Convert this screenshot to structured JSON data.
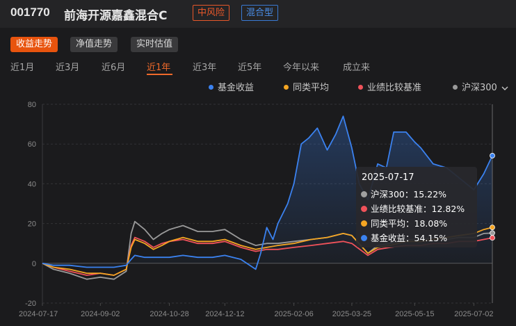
{
  "header": {
    "fund_code": "001770",
    "fund_name": "前海开源嘉鑫混合C",
    "risk_badge": "中风险",
    "type_badge": "混合型"
  },
  "view_tabs": [
    {
      "label": "收益走势",
      "active": true
    },
    {
      "label": "净值走势",
      "active": false
    },
    {
      "label": "实时估值",
      "active": false
    }
  ],
  "period_tabs": [
    {
      "label": "近1月",
      "active": false
    },
    {
      "label": "近3月",
      "active": false
    },
    {
      "label": "近6月",
      "active": false
    },
    {
      "label": "近1年",
      "active": true
    },
    {
      "label": "近3年",
      "active": false
    },
    {
      "label": "近5年",
      "active": false
    },
    {
      "label": "今年以来",
      "active": false
    },
    {
      "label": "成立来",
      "active": false
    }
  ],
  "legend": [
    {
      "label": "基金收益",
      "color": "#3b82f0"
    },
    {
      "label": "同类平均",
      "color": "#f5a623"
    },
    {
      "label": "业绩比较基准",
      "color": "#f0525a"
    },
    {
      "label": "沪深300",
      "color": "#9a9a9a"
    }
  ],
  "legend_more_icon": "chevron-down-icon",
  "tooltip": {
    "date": "2025-07-17",
    "rows": [
      {
        "label": "沪深300：15.22%",
        "color": "#a0a0a0"
      },
      {
        "label": "业绩比较基准：12.82%",
        "color": "#f0525a"
      },
      {
        "label": "同类平均：18.08%",
        "color": "#f5a623"
      },
      {
        "label": "基金收益：54.15%",
        "color": "#3b82f0"
      }
    ]
  },
  "chart_data": {
    "type": "line",
    "y_ticks": [
      "80",
      "60",
      "40",
      "20",
      "0",
      "-20"
    ],
    "x_ticks": [
      "2024-07-17",
      "2024-09-02",
      "2024-10-28",
      "2024-12-12",
      "2025-02-06",
      "2025-03-25",
      "2025-05-15",
      "2025-07-02"
    ],
    "ylim": [
      -20,
      80
    ],
    "xlim": [
      "2024-07-17",
      "2025-07-17"
    ],
    "grid": true,
    "legend_position": "top-right",
    "series": [
      {
        "name": "沪深300",
        "color": "#9a9a9a",
        "points": [
          [
            "2024-07-17",
            0
          ],
          [
            "2024-07-26",
            -3
          ],
          [
            "2024-08-08",
            -5
          ],
          [
            "2024-08-22",
            -8
          ],
          [
            "2024-09-02",
            -7
          ],
          [
            "2024-09-13",
            -8
          ],
          [
            "2024-09-23",
            -4
          ],
          [
            "2024-09-27",
            15
          ],
          [
            "2024-09-30",
            21
          ],
          [
            "2024-10-08",
            17
          ],
          [
            "2024-10-15",
            12
          ],
          [
            "2024-10-22",
            15
          ],
          [
            "2024-10-28",
            17
          ],
          [
            "2024-11-08",
            19
          ],
          [
            "2024-11-20",
            16
          ],
          [
            "2024-12-02",
            16
          ],
          [
            "2024-12-12",
            17
          ],
          [
            "2024-12-25",
            12
          ],
          [
            "2025-01-06",
            9
          ],
          [
            "2025-01-15",
            10
          ],
          [
            "2025-01-24",
            10
          ],
          [
            "2025-02-06",
            11
          ],
          [
            "2025-02-20",
            12
          ],
          [
            "2025-03-05",
            13
          ],
          [
            "2025-03-18",
            15
          ],
          [
            "2025-03-25",
            14
          ],
          [
            "2025-04-07",
            5
          ],
          [
            "2025-04-15",
            9
          ],
          [
            "2025-04-25",
            10
          ],
          [
            "2025-05-08",
            12
          ],
          [
            "2025-05-20",
            12
          ],
          [
            "2025-05-30",
            13
          ],
          [
            "2025-06-10",
            12
          ],
          [
            "2025-06-20",
            13
          ],
          [
            "2025-07-02",
            13
          ],
          [
            "2025-07-10",
            15
          ],
          [
            "2025-07-17",
            15.22
          ]
        ]
      },
      {
        "name": "业绩比较基准",
        "color": "#f0525a",
        "points": [
          [
            "2024-07-17",
            0
          ],
          [
            "2024-07-26",
            -2
          ],
          [
            "2024-08-08",
            -4
          ],
          [
            "2024-08-22",
            -6
          ],
          [
            "2024-09-02",
            -5
          ],
          [
            "2024-09-13",
            -6
          ],
          [
            "2024-09-23",
            -3
          ],
          [
            "2024-09-27",
            9
          ],
          [
            "2024-09-30",
            13
          ],
          [
            "2024-10-08",
            11
          ],
          [
            "2024-10-15",
            8
          ],
          [
            "2024-10-22",
            10
          ],
          [
            "2024-10-28",
            11
          ],
          [
            "2024-11-08",
            12
          ],
          [
            "2024-11-20",
            10
          ],
          [
            "2024-12-02",
            10
          ],
          [
            "2024-12-12",
            11
          ],
          [
            "2024-12-25",
            8
          ],
          [
            "2025-01-06",
            6
          ],
          [
            "2025-01-15",
            7
          ],
          [
            "2025-01-24",
            7
          ],
          [
            "2025-02-06",
            8
          ],
          [
            "2025-02-20",
            9
          ],
          [
            "2025-03-05",
            10
          ],
          [
            "2025-03-18",
            11
          ],
          [
            "2025-03-25",
            10
          ],
          [
            "2025-04-07",
            4
          ],
          [
            "2025-04-15",
            7
          ],
          [
            "2025-04-25",
            8
          ],
          [
            "2025-05-08",
            9
          ],
          [
            "2025-05-20",
            9
          ],
          [
            "2025-05-30",
            10
          ],
          [
            "2025-06-10",
            10
          ],
          [
            "2025-06-20",
            11
          ],
          [
            "2025-07-02",
            11
          ],
          [
            "2025-07-10",
            12
          ],
          [
            "2025-07-17",
            12.82
          ]
        ]
      },
      {
        "name": "同类平均",
        "color": "#f5a623",
        "points": [
          [
            "2024-07-17",
            0
          ],
          [
            "2024-07-26",
            -2
          ],
          [
            "2024-08-08",
            -3
          ],
          [
            "2024-08-22",
            -5
          ],
          [
            "2024-09-02",
            -5
          ],
          [
            "2024-09-13",
            -6
          ],
          [
            "2024-09-23",
            -3
          ],
          [
            "2024-09-27",
            8
          ],
          [
            "2024-09-30",
            12
          ],
          [
            "2024-10-08",
            10
          ],
          [
            "2024-10-15",
            7
          ],
          [
            "2024-10-22",
            9
          ],
          [
            "2024-10-28",
            11
          ],
          [
            "2024-11-08",
            13
          ],
          [
            "2024-11-20",
            11
          ],
          [
            "2024-12-02",
            11
          ],
          [
            "2024-12-12",
            12
          ],
          [
            "2024-12-25",
            9
          ],
          [
            "2025-01-06",
            7
          ],
          [
            "2025-01-15",
            8
          ],
          [
            "2025-01-24",
            9
          ],
          [
            "2025-02-06",
            10
          ],
          [
            "2025-02-20",
            12
          ],
          [
            "2025-03-05",
            13
          ],
          [
            "2025-03-18",
            15
          ],
          [
            "2025-03-25",
            14
          ],
          [
            "2025-04-07",
            5
          ],
          [
            "2025-04-15",
            8
          ],
          [
            "2025-04-25",
            9
          ],
          [
            "2025-05-08",
            11
          ],
          [
            "2025-05-20",
            11
          ],
          [
            "2025-05-30",
            12
          ],
          [
            "2025-06-10",
            13
          ],
          [
            "2025-06-20",
            14
          ],
          [
            "2025-07-02",
            15
          ],
          [
            "2025-07-10",
            17
          ],
          [
            "2025-07-17",
            18.08
          ]
        ]
      },
      {
        "name": "基金收益",
        "color": "#3b82f0",
        "points": [
          [
            "2024-07-17",
            0
          ],
          [
            "2024-07-26",
            -1
          ],
          [
            "2024-08-08",
            -1
          ],
          [
            "2024-08-22",
            -2
          ],
          [
            "2024-09-02",
            -2
          ],
          [
            "2024-09-13",
            -2
          ],
          [
            "2024-09-23",
            -1
          ],
          [
            "2024-09-27",
            2
          ],
          [
            "2024-09-30",
            4
          ],
          [
            "2024-10-08",
            3
          ],
          [
            "2024-10-15",
            3
          ],
          [
            "2024-10-22",
            3
          ],
          [
            "2024-10-28",
            3
          ],
          [
            "2024-11-08",
            4
          ],
          [
            "2024-11-20",
            3
          ],
          [
            "2024-12-02",
            3
          ],
          [
            "2024-12-12",
            4
          ],
          [
            "2024-12-25",
            2
          ],
          [
            "2025-01-06",
            -3
          ],
          [
            "2025-01-10",
            5
          ],
          [
            "2025-01-15",
            18
          ],
          [
            "2025-01-20",
            12
          ],
          [
            "2025-01-24",
            20
          ],
          [
            "2025-02-01",
            30
          ],
          [
            "2025-02-06",
            40
          ],
          [
            "2025-02-12",
            60
          ],
          [
            "2025-02-18",
            63
          ],
          [
            "2025-02-25",
            68
          ],
          [
            "2025-03-05",
            57
          ],
          [
            "2025-03-12",
            65
          ],
          [
            "2025-03-18",
            74
          ],
          [
            "2025-03-25",
            58
          ],
          [
            "2025-03-31",
            40
          ],
          [
            "2025-04-07",
            32
          ],
          [
            "2025-04-15",
            50
          ],
          [
            "2025-04-22",
            48
          ],
          [
            "2025-04-28",
            66
          ],
          [
            "2025-05-08",
            66
          ],
          [
            "2025-05-15",
            61
          ],
          [
            "2025-05-20",
            58
          ],
          [
            "2025-05-30",
            50
          ],
          [
            "2025-06-10",
            48
          ],
          [
            "2025-06-20",
            43
          ],
          [
            "2025-07-02",
            37
          ],
          [
            "2025-07-10",
            45
          ],
          [
            "2025-07-17",
            54.15
          ]
        ]
      }
    ]
  }
}
